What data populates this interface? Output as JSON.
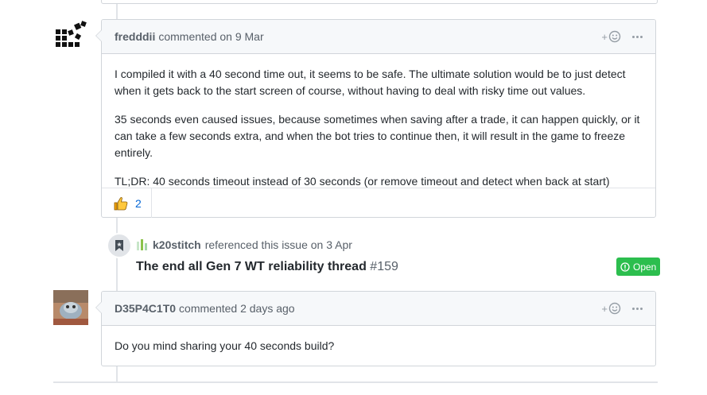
{
  "comments": [
    {
      "author": "fredddii",
      "action": "commented on 9 Mar",
      "paragraphs": [
        "I compiled it with a 40 second time out, it seems to be safe. The ultimate solution would be to just detect when it gets back to the start screen of course, without having to deal with risky time out values.",
        "35 seconds even caused issues, because sometimes when saving after a trade, it can happen quickly, or it can take a few seconds extra, and when the bot tries to continue then, it will result in the game to freeze entirely.",
        "TL;DR: 40 seconds timeout instead of 30 seconds (or remove timeout and detect when back at start)"
      ],
      "reaction": {
        "emoji": "thumbs-up",
        "count": "2"
      }
    },
    {
      "author": "D35P4C1T0",
      "action": "commented 2 days ago",
      "paragraphs": [
        "Do you mind sharing your 40 seconds build?"
      ]
    }
  ],
  "reference": {
    "author": "k20stitch",
    "action": "referenced this issue on 3 Apr",
    "title": "The end all Gen 7 WT reliability thread",
    "number": "#159",
    "status": "Open"
  },
  "ui": {
    "add_reaction_label": "+",
    "icons": [
      "identicon-avatar",
      "photo-avatar",
      "smiley-icon",
      "kebab-icon",
      "bookmark-icon",
      "repo-bars-icon",
      "issue-opened-icon"
    ],
    "colors": {
      "open_badge": "#2cbe4e",
      "link": "#0366d6",
      "header_bg": "#f6f8fa",
      "border": "#d1d5da"
    }
  }
}
